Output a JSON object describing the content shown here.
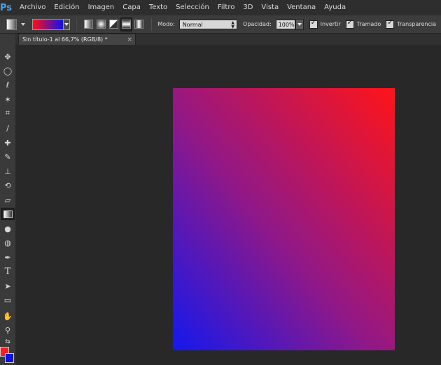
{
  "app": {
    "logo": "Ps"
  },
  "menu": [
    "Archivo",
    "Edición",
    "Imagen",
    "Capa",
    "Texto",
    "Selección",
    "Filtro",
    "3D",
    "Vista",
    "Ventana",
    "Ayuda"
  ],
  "options": {
    "gradient_colors": {
      "start": "#ff1010",
      "end": "#1010f0"
    },
    "mode_label": "Modo:",
    "mode_value": "Normal",
    "opacity_label": "Opacidad:",
    "opacity_value": "100%",
    "checks": [
      {
        "label": "Invertir",
        "checked": true
      },
      {
        "label": "Tramado",
        "checked": true
      },
      {
        "label": "Transparencia",
        "checked": true
      }
    ]
  },
  "document": {
    "tab_title": "Sin título-1 al 66,7% (RGB/8) *"
  },
  "tools": [
    "move-tool-icon",
    "marquee-tool-icon",
    "lasso-tool-icon",
    "magic-wand-tool-icon",
    "crop-tool-icon",
    "eyedropper-tool-icon",
    "healing-brush-tool-icon",
    "brush-tool-icon",
    "clone-stamp-tool-icon",
    "history-brush-tool-icon",
    "eraser-tool-icon",
    "gradient-tool-icon",
    "blur-tool-icon",
    "dodge-tool-icon",
    "pen-tool-icon",
    "type-tool-icon",
    "path-selection-tool-icon",
    "rectangle-tool-icon",
    "hand-tool-icon",
    "zoom-tool-icon"
  ],
  "colors": {
    "foreground": "#ff1c1c",
    "background": "#1010e0",
    "gradient_top_right": "#ff1418",
    "gradient_bottom_left": "#1418ee"
  }
}
